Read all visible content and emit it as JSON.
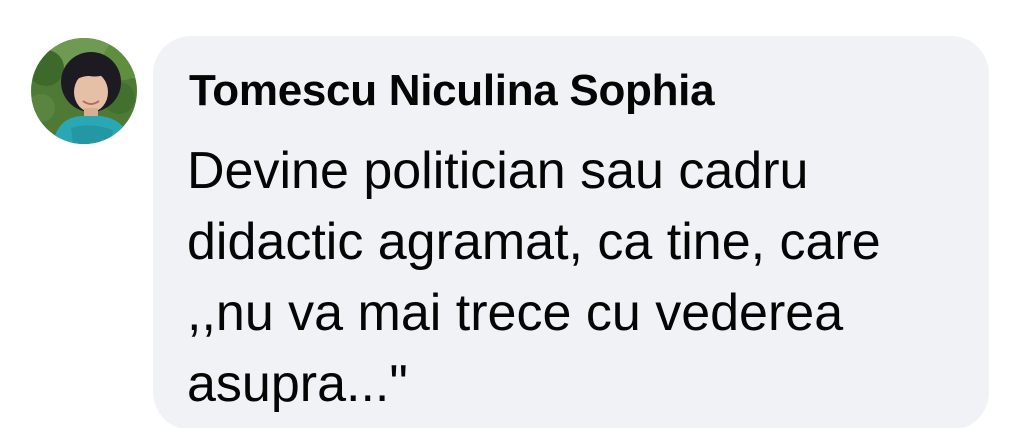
{
  "comment": {
    "author": "Tomescu Niculina Sophia",
    "text": "Devine politician sau cadru\ndidactic agramat, ca tine, care\n,,nu va mai trece cu vederea\nasupra...\""
  },
  "avatar": {
    "icon": "profile-photo"
  },
  "colors": {
    "bubble_background": "#f0f2f5",
    "text": "#050505"
  }
}
